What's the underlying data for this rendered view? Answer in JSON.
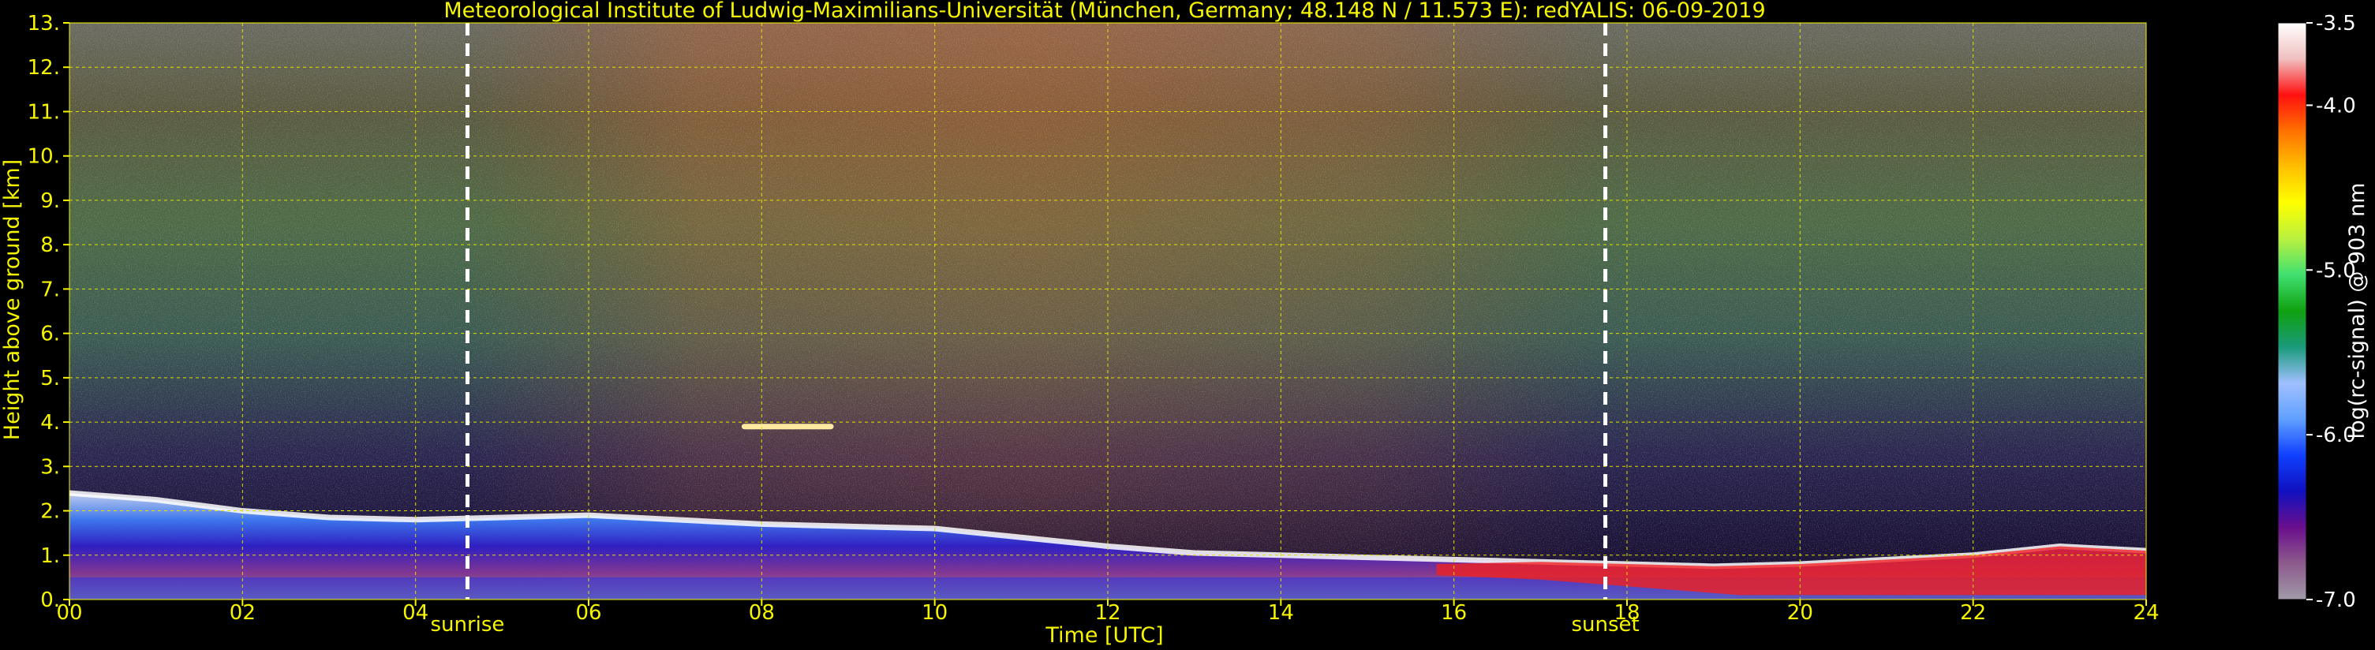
{
  "chart_data": {
    "type": "heatmap",
    "title": "Meteorological Institute of Ludwig-Maximilians-Universität (München, Germany; 48.148 N / 11.573 E):    redYALIS: 06-09-2019",
    "xlabel": "Time [UTC]",
    "ylabel": "Height above ground [km]",
    "xlim": [
      0,
      24
    ],
    "ylim": [
      0,
      13
    ],
    "x_ticks": [
      0,
      2,
      4,
      6,
      8,
      10,
      12,
      14,
      16,
      18,
      20,
      22,
      24
    ],
    "x_tick_labels": [
      "00",
      "02",
      "04",
      "06",
      "08",
      "10",
      "12",
      "14",
      "16",
      "18",
      "20",
      "22",
      "24"
    ],
    "y_ticks": [
      0,
      1,
      2,
      3,
      4,
      5,
      6,
      7,
      8,
      9,
      10,
      11,
      12,
      13
    ],
    "y_tick_labels": [
      "0.",
      "1.",
      "2.",
      "3.",
      "4.",
      "5.",
      "6.",
      "7.",
      "8.",
      "9.",
      "10.",
      "11.",
      "12.",
      "13."
    ],
    "grid": true,
    "annotations": [
      {
        "text": "sunrise",
        "x": 4.6
      },
      {
        "text": "sunset",
        "x": 17.75
      }
    ],
    "colorbar": {
      "label": "log(rc-signal) @ 903 nm",
      "range": [
        -7.0,
        -3.5
      ],
      "ticks": [
        -7.0,
        -6.0,
        -5.0,
        -4.0,
        -3.5
      ],
      "tick_labels": [
        "-7.0",
        "-6.0",
        "-5.0",
        "-4.0",
        "-3.5"
      ],
      "placement": "right"
    },
    "layers": [
      {
        "feature": "boundary layer top",
        "start_time": 0,
        "heights_km": [
          [
            0,
            2.4
          ],
          [
            1,
            2.25
          ],
          [
            2,
            2.0
          ],
          [
            3,
            1.85
          ],
          [
            4,
            1.8
          ],
          [
            5,
            1.85
          ],
          [
            6,
            1.9
          ],
          [
            7,
            1.8
          ],
          [
            8,
            1.7
          ],
          [
            9,
            1.65
          ],
          [
            10,
            1.6
          ],
          [
            11,
            1.4
          ],
          [
            12,
            1.2
          ],
          [
            13,
            1.05
          ],
          [
            14,
            1.0
          ],
          [
            15,
            0.95
          ],
          [
            16,
            0.9
          ],
          [
            17,
            0.85
          ],
          [
            18,
            0.8
          ],
          [
            19,
            0.75
          ],
          [
            20,
            0.8
          ],
          [
            21,
            0.9
          ],
          [
            22,
            1.0
          ],
          [
            23,
            1.2
          ],
          [
            24,
            1.1
          ]
        ]
      },
      {
        "feature": "elevated aerosol layer",
        "time_range": [
          7.8,
          8.8
        ],
        "height_km": 3.9
      }
    ],
    "vertical_lines": [
      {
        "name": "sunrise",
        "x": 4.6,
        "style": "dashed",
        "color": "#ffffff"
      },
      {
        "name": "sunset",
        "x": 17.75,
        "style": "dashed",
        "color": "#ffffff"
      }
    ],
    "colors": {
      "text": "#f5f500",
      "grid": "#e0e000",
      "background": "#000000",
      "colormap": [
        "#a09aa8",
        "#8c5a8c",
        "#6a0f8c",
        "#1010c0",
        "#1040ff",
        "#60a0ff",
        "#a0c0ff",
        "#1a9a7a",
        "#10a010",
        "#40e070",
        "#b8f040",
        "#ffff00",
        "#ffc000",
        "#ff7000",
        "#ff1010",
        "#f0c0c0",
        "#ffffff"
      ]
    }
  }
}
